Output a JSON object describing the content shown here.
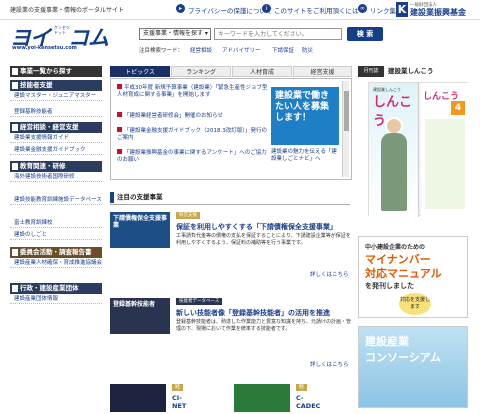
{
  "topbar": {
    "tagline": "建設業の支援事業・情報のポータルサイト",
    "privacy": "プライバシーの保護について",
    "terms": "このサイトをご利用頂くには",
    "links": "リンク集",
    "sponsor_sub": "一般財団法人",
    "sponsor_name": "建設業振興基金"
  },
  "logo": {
    "main": "ヨイ",
    "main2": "コム",
    "kana": "ケンセツ\nドット",
    "url": "www.yoi-kensetsu.com"
  },
  "search": {
    "select": "支援事業・情報を探す",
    "placeholder": "キーワードを入力してください。",
    "button": "検 索",
    "keywords_label": "注目検索ワード：",
    "keywords": [
      "経営相談",
      "アドバイザリー",
      "下請保証",
      "防災"
    ]
  },
  "sidebar": {
    "list_head": "事業一覧から探す",
    "sections": [
      {
        "title": "技能者支援",
        "items": [
          "建設マスター・ジュニアマスター",
          "登録基幹技能者"
        ]
      },
      {
        "title": "経営相談・経営支援",
        "items": [
          "建設業支援情報ガイド",
          "建設業金融支援ガイドブック"
        ]
      },
      {
        "title": "教育関連・研修",
        "items": [
          "海外建設技術者国際研修",
          "建設技能教育訓練施設データベース",
          "富士教育訓練校",
          "建設のしごと"
        ]
      },
      {
        "title": "委員会活動・調査報告書",
        "items": [
          "建設産業人材確保・育成推進協議会"
        ]
      },
      {
        "title": "行政・建設産業団体",
        "items": [
          "建設産業団体情報"
        ]
      }
    ]
  },
  "tabs": [
    "トピックス",
    "ランキング",
    "人材育成",
    "経営支援"
  ],
  "news": [
    "平成30年度 新規予算事業（建設業）「緊急生産性ジョブ型人材育成に関する事業」を開始します",
    "「建設業経営者研修会」開催のお知らせ",
    "「建設業金融支援ガイドブック（2018.3改訂版）」発行のご案内",
    "「建設業振興基金の事業に関するアンケート」へのご協力のお願い"
  ],
  "news_side": "建設業で働きたい人を募集します！",
  "news_side2": "建設業の魅力を伝える「建設業しごとナビ」へ",
  "monthly": {
    "label": "月刊誌",
    "title": "建設業しんこう",
    "cover": "しんこう",
    "issue": "4"
  },
  "support_section": "注目の支援事業",
  "cards": [
    {
      "category": "経営支援",
      "thumb": "下請債権保全支援事業",
      "title": "保証を利用しやすくする「下請債権保全支援事業」",
      "desc": "工事請負代金等の債権の支払を保証することにより、下請建設企業等が保証を利用しやすくするよう、保証料の補助等を行う事業です。",
      "more": "詳しくはこちら"
    },
    {
      "category": "技能者データベース",
      "thumb": "登録基幹技能者",
      "title": "新しい技能者像「登録基幹技能者」の活用を推進",
      "desc": "登録基幹技能者は、熟達した作業能力と豊富な知識を持ち、元請けの計画・管理の下、現場において作業を統率する技能者です。",
      "more": "詳しくはこちら"
    }
  ],
  "bottom_logos": [
    {
      "cat": "経営支援",
      "name": "CI-NET"
    },
    {
      "cat": "経営支援",
      "name": "C-CADEC"
    }
  ],
  "ads": {
    "mynumber_l1": "中小建設企業のための",
    "mynumber_l2": "マイナンバー",
    "mynumber_l3": "対応マニュアル",
    "mynumber_l4": "を発刊しました",
    "mynumber_badge": "対応を支援します",
    "consortium_l1": "建設産業",
    "consortium_l2": "コンソーシアム"
  }
}
